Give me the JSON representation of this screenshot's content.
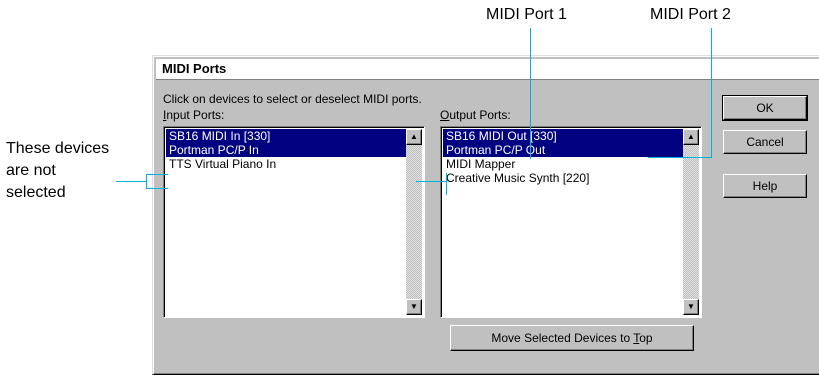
{
  "callouts": {
    "port1": "MIDI Port 1",
    "port2": "MIDI Port 2",
    "not_selected": [
      "These devices",
      "are not",
      "selected"
    ]
  },
  "dialog": {
    "title": "MIDI Ports",
    "close_glyph": "✕",
    "instruction": "Click on devices to select or deselect MIDI ports.",
    "input_label_first": "I",
    "input_label_rest": "nput Ports:",
    "output_label_first": "O",
    "output_label_rest": "utput Ports:",
    "input_ports": [
      {
        "label": "SB16 MIDI In [330]",
        "selected": true
      },
      {
        "label": "Portman PC/P In",
        "selected": true
      },
      {
        "label": "TTS Virtual Piano In",
        "selected": false
      }
    ],
    "output_ports": [
      {
        "label": "SB16 MIDI Out [330]",
        "selected": true
      },
      {
        "label": "Portman PC/P Out",
        "selected": true
      },
      {
        "label": "MIDI Mapper",
        "selected": false
      },
      {
        "label": "Creative Music Synth [220]",
        "selected": false
      }
    ],
    "move_button_pre": "Move Selected Devices to ",
    "move_button_accel": "T",
    "move_button_post": "op",
    "ok_label": "OK",
    "cancel_label": "Cancel",
    "help_label": "Help",
    "scroll_up_glyph": "▲",
    "scroll_down_glyph": "▼"
  }
}
